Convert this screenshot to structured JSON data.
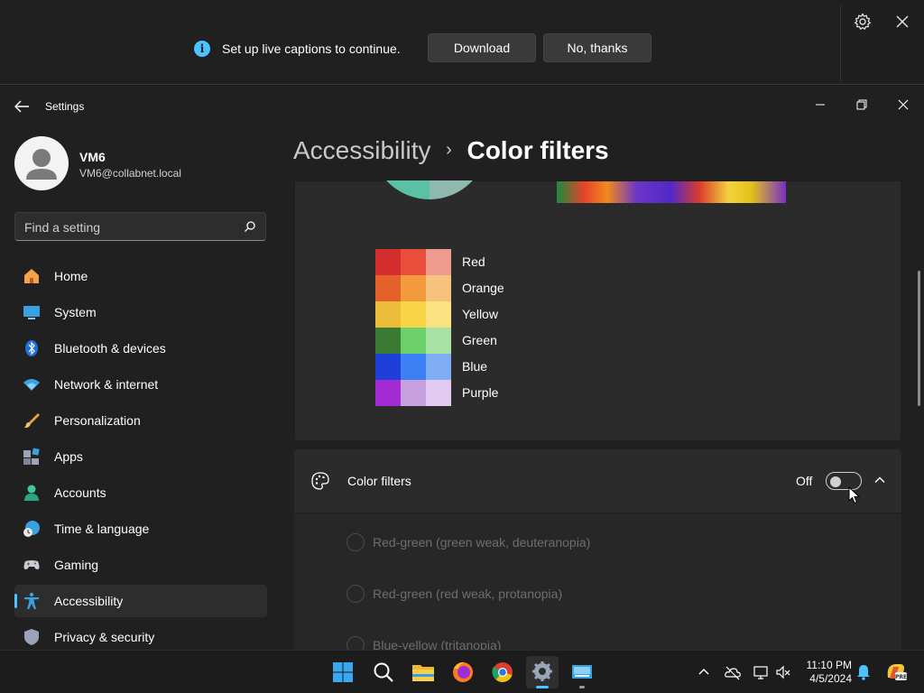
{
  "captions": {
    "message": "Set up live captions to continue.",
    "download_label": "Download",
    "no_thanks_label": "No, thanks",
    "info_glyph": "i",
    "icons": [
      "info-icon",
      "gear-icon",
      "close-icon"
    ]
  },
  "window": {
    "title": "Settings",
    "controls": [
      "minimize-icon",
      "maximize-icon",
      "close-icon"
    ]
  },
  "user": {
    "name": "VM6",
    "email": "VM6@collabnet.local"
  },
  "search": {
    "placeholder": "Find a setting"
  },
  "nav": {
    "items": [
      {
        "label": "Home",
        "icon": "home-icon"
      },
      {
        "label": "System",
        "icon": "system-icon"
      },
      {
        "label": "Bluetooth & devices",
        "icon": "bluetooth-icon"
      },
      {
        "label": "Network & internet",
        "icon": "wifi-icon"
      },
      {
        "label": "Personalization",
        "icon": "brush-icon"
      },
      {
        "label": "Apps",
        "icon": "apps-icon"
      },
      {
        "label": "Accounts",
        "icon": "accounts-icon"
      },
      {
        "label": "Time & language",
        "icon": "globe-clock-icon"
      },
      {
        "label": "Gaming",
        "icon": "gamepad-icon"
      },
      {
        "label": "Accessibility",
        "icon": "accessibility-icon",
        "active": true
      },
      {
        "label": "Privacy & security",
        "icon": "shield-icon"
      }
    ]
  },
  "breadcrumb": {
    "parent": "Accessibility",
    "separator": "›",
    "current": "Color filters"
  },
  "color_swatches": [
    {
      "label": "Red",
      "colors": [
        "#d42d2d",
        "#ea4f3d",
        "#ef9a8e"
      ]
    },
    {
      "label": "Orange",
      "colors": [
        "#e4622a",
        "#f39a3d",
        "#f7c27d"
      ]
    },
    {
      "label": "Yellow",
      "colors": [
        "#ecbd3b",
        "#f9d446",
        "#f9e27f"
      ]
    },
    {
      "label": "Green",
      "colors": [
        "#3a7a33",
        "#6bcf6a",
        "#a6e2a3"
      ]
    },
    {
      "label": "Blue",
      "colors": [
        "#1e3fd8",
        "#3d7ff4",
        "#7faef4"
      ]
    },
    {
      "label": "Purple",
      "colors": [
        "#a22bd4",
        "#c8a0e0",
        "#e1c9ef"
      ]
    }
  ],
  "color_filters": {
    "title": "Color filters",
    "state": "Off",
    "enabled": false,
    "options": [
      "Red-green (green weak, deuteranopia)",
      "Red-green (red weak, protanopia)",
      "Blue-yellow (tritanopia)"
    ]
  },
  "taskbar": {
    "apps": [
      "windows-start-icon",
      "search-icon",
      "file-explorer-icon",
      "firefox-icon",
      "chrome-icon",
      "settings-icon",
      "remote-desktop-icon"
    ],
    "tray": [
      "chevron-up-icon",
      "onedrive-offline-icon",
      "display-icon",
      "volume-muted-icon",
      "notification-bell-icon",
      "copilot-icon"
    ],
    "time": "11:10 PM",
    "date": "4/5/2024"
  },
  "colors": {
    "accent": "#4cc2ff",
    "background": "#202020",
    "card": "#2b2b2b"
  }
}
